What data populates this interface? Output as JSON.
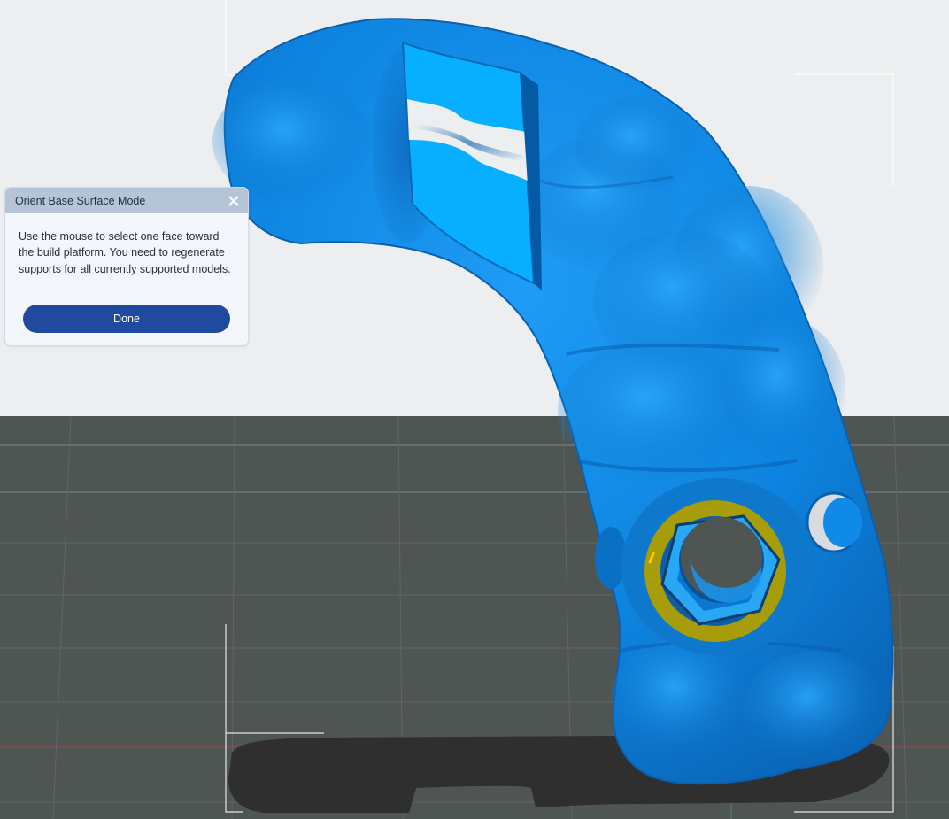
{
  "dialog": {
    "title": "Orient Base Surface Mode",
    "close_icon": "close-icon",
    "message": "Use the mouse to select one face toward the build platform. You need to regenerate supports for all currently supported models.",
    "done_label": "Done"
  },
  "viewport": {
    "background": "#eceef0",
    "plate_color": "#4f5553",
    "model_color": "#0e86e3",
    "selection_color": "#b6a500"
  }
}
